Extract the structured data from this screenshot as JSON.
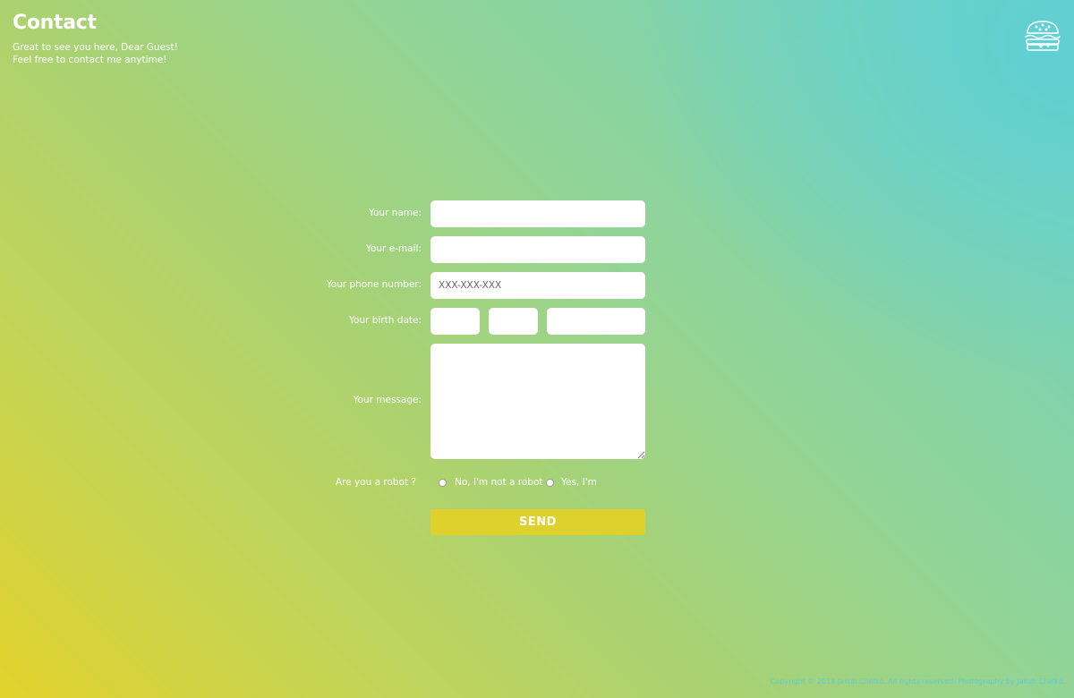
{
  "header": {
    "title": "Contact",
    "subtitle_line1": "Great to see you here, Dear Guest!",
    "subtitle_line2": "Feel free to contact me anytime!"
  },
  "menu": {
    "icon": "hamburger-icon"
  },
  "form": {
    "name_label": "Your name:",
    "email_label": "Your e-mail:",
    "phone_label": "Your phone number:",
    "phone_placeholder": "XXX-XXX-XXX",
    "birth_label": "Your birth date:",
    "message_label": "Your message:",
    "robot_label": "Are you a robot ?",
    "robot_no": "No, I'm not a robot",
    "robot_yes": "Yes, I'm",
    "send_label": "SEND"
  },
  "footer": {
    "text": "Copyright © 2018 Jakub Chelkó. All rights reserved. Photography by Jakub Chelkó."
  },
  "colors": {
    "accent": "#dfd12d",
    "gradient_start": "#e2d22c",
    "gradient_end": "#5fd0d4",
    "footer_text": "#62cdd2"
  }
}
